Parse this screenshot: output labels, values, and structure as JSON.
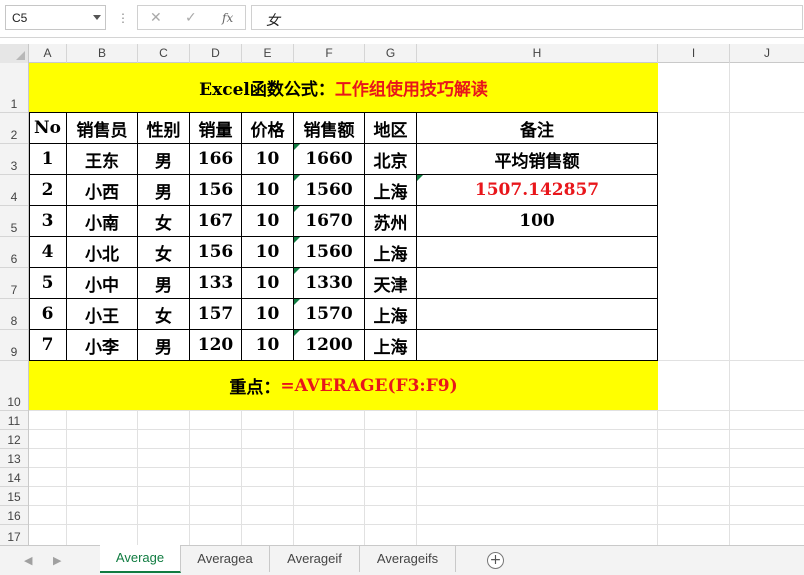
{
  "formula_bar": {
    "name_box": "C5",
    "cancel_icon": "✕",
    "enter_icon": "✓",
    "fx_label": "fx",
    "content": "女"
  },
  "columns": [
    "A",
    "B",
    "C",
    "D",
    "E",
    "F",
    "G",
    "H",
    "I",
    "J"
  ],
  "rows": [
    "1",
    "2",
    "3",
    "4",
    "5",
    "6",
    "7",
    "8",
    "9",
    "10",
    "11",
    "12",
    "13",
    "14",
    "15",
    "16",
    "17"
  ],
  "title": {
    "black": "Excel函数公式：",
    "red": "工作组使用技巧解读"
  },
  "table": {
    "headers": [
      "No",
      "销售员",
      "性别",
      "销量",
      "价格",
      "销售额",
      "地区",
      "备注"
    ],
    "rows": [
      [
        "1",
        "王东",
        "男",
        "166",
        "10",
        "1660",
        "北京"
      ],
      [
        "2",
        "小西",
        "男",
        "156",
        "10",
        "1560",
        "上海"
      ],
      [
        "3",
        "小南",
        "女",
        "167",
        "10",
        "1670",
        "苏州"
      ],
      [
        "4",
        "小北",
        "女",
        "156",
        "10",
        "1560",
        "上海"
      ],
      [
        "5",
        "小中",
        "男",
        "133",
        "10",
        "1330",
        "天津"
      ],
      [
        "6",
        "小王",
        "女",
        "157",
        "10",
        "1570",
        "上海"
      ],
      [
        "7",
        "小李",
        "男",
        "120",
        "10",
        "1200",
        "上海"
      ]
    ],
    "notes": [
      "平均销售额",
      "1507.142857",
      "100"
    ]
  },
  "footer": {
    "black": "重点：",
    "red": "=AVERAGE(F3:F9)"
  },
  "sheet_tabs": [
    "Average",
    "Averagea",
    "Averageif",
    "Averageifs"
  ],
  "active_tab": "Average",
  "colors": {
    "highlight": "#ffff00",
    "red_text": "#e8161b",
    "excel_green": "#107c41"
  }
}
